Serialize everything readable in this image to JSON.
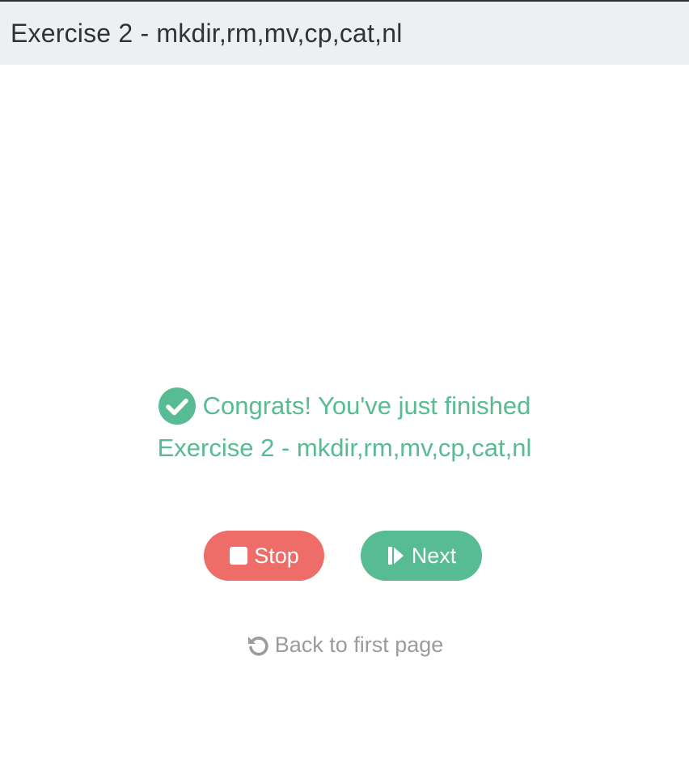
{
  "header": {
    "title": "Exercise 2 - mkdir,rm,mv,cp,cat,nl"
  },
  "result": {
    "message": "Congrats! You've just finished",
    "exercise_name": "Exercise 2 - mkdir,rm,mv,cp,cat,nl",
    "icon": "check-circle-icon"
  },
  "actions": {
    "stop_label": "Stop",
    "stop_icon": "stop-icon",
    "next_label": "Next",
    "next_icon": "step-forward-icon",
    "back_label": "Back to first page",
    "back_icon": "undo-icon"
  },
  "colors": {
    "success": "#57bb94",
    "danger": "#ee6d68",
    "muted": "#9b9b9b",
    "header_bg": "#eeeff0"
  }
}
